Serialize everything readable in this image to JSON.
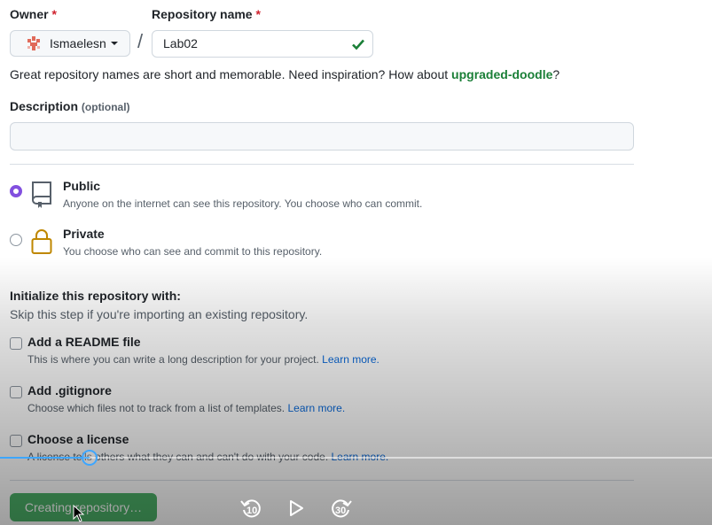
{
  "owner": {
    "label": "Owner",
    "required_mark": "*",
    "name": "Ismaelesn"
  },
  "repo": {
    "label": "Repository name",
    "required_mark": "*",
    "value": "Lab02",
    "separator": "/"
  },
  "hint": {
    "text": "Great repository names are short and memorable. Need inspiration? How about ",
    "suggestion": "upgraded-doodle",
    "end": "?"
  },
  "description": {
    "label": "Description",
    "optional": "(optional)",
    "value": ""
  },
  "visibility": {
    "public": {
      "title": "Public",
      "subtitle": "Anyone on the internet can see this repository. You choose who can commit.",
      "selected": true
    },
    "private": {
      "title": "Private",
      "subtitle": "You choose who can see and commit to this repository.",
      "selected": false
    }
  },
  "init": {
    "title": "Initialize this repository with:",
    "subtitle": "Skip this step if you're importing an existing repository.",
    "options": [
      {
        "title": "Add a README file",
        "subtitle": "This is where you can write a long description for your project.",
        "link": "Learn more."
      },
      {
        "title": "Add .gitignore",
        "subtitle": "Choose which files not to track from a list of templates.",
        "link": "Learn more."
      },
      {
        "title": "Choose a license",
        "subtitle": "A license tells others what they can and can't do with your code.",
        "link": "Learn more."
      }
    ]
  },
  "create_button": "Creating repository…",
  "player": {
    "rewind_seconds": "10",
    "forward_seconds": "30",
    "progress_fraction": 0.126
  },
  "colors": {
    "accent": "#8250df",
    "success": "#1a7f37",
    "link": "#0969da",
    "scrubber": "#3ea6ff"
  }
}
